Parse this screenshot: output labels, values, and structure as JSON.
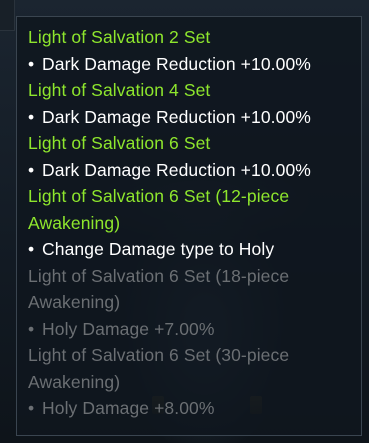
{
  "tooltip": {
    "colors": {
      "active_title": "#8ee62d",
      "active_text": "#ffffff",
      "inactive": "#6b6f73"
    },
    "bullet": "•",
    "entries": [
      {
        "title": "Light of Salvation 2 Set",
        "effect": "Dark Damage Reduction +10.00%",
        "active": true
      },
      {
        "title": "Light of Salvation 4 Set",
        "effect": "Dark Damage Reduction +10.00%",
        "active": true
      },
      {
        "title": "Light of Salvation 6 Set",
        "effect": "Dark Damage Reduction +10.00%",
        "active": true
      },
      {
        "title_line1": "Light of Salvation 6 Set (12-piece",
        "title_line2": "Awakening)",
        "effect": "Change Damage type to Holy",
        "active": true
      },
      {
        "title_line1": "Light of Salvation 6 Set (18-piece",
        "title_line2": "Awakening)",
        "effect": "Holy Damage +7.00%",
        "active": false
      },
      {
        "title_line1": "Light of Salvation 6 Set (30-piece",
        "title_line2": "Awakening)",
        "effect": "Holy Damage +8.00%",
        "active": false
      }
    ]
  }
}
